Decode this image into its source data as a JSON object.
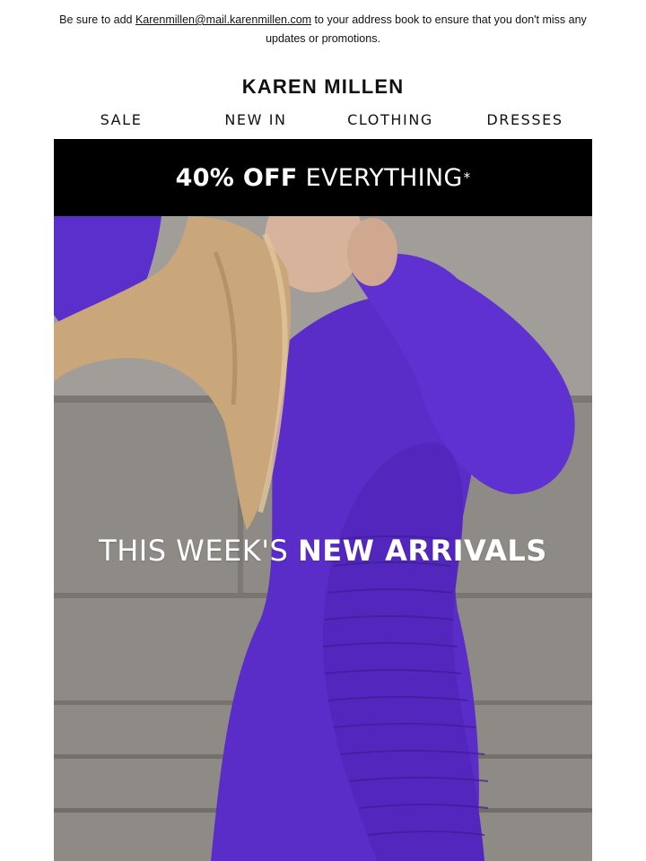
{
  "preheader": {
    "prefix": "Be sure to add",
    "email_link": "Karenmillen@mail.karenmillen.com",
    "suffix": "to your address book to ensure that you don't miss any",
    "line2": "updates or promotions."
  },
  "brand": {
    "name": "KAREN MILLEN"
  },
  "nav": {
    "items": [
      {
        "label": "SALE"
      },
      {
        "label": "NEW IN"
      },
      {
        "label": "CLOTHING"
      },
      {
        "label": "DRESSES"
      }
    ]
  },
  "promo": {
    "bold_text": "40% OFF",
    "light_text": "EVERYTHING",
    "asterisk": "*"
  },
  "hero": {
    "title_light": "THIS WEEK'S",
    "title_bold": "NEW ARRIVALS",
    "image_alt": "Model wearing purple ruched long-sleeve dress",
    "dress_color": "#5a2dc8",
    "hair_color": "#c9a77a",
    "wall_color": "#8c8884"
  }
}
